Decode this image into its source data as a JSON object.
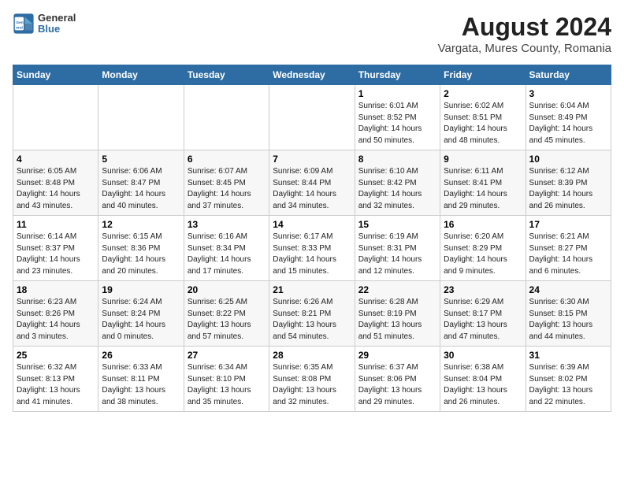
{
  "header": {
    "logo_line1": "General",
    "logo_line2": "Blue",
    "title": "August 2024",
    "subtitle": "Vargata, Mures County, Romania"
  },
  "days_of_week": [
    "Sunday",
    "Monday",
    "Tuesday",
    "Wednesday",
    "Thursday",
    "Friday",
    "Saturday"
  ],
  "weeks": [
    [
      {
        "day": "",
        "sunrise": "",
        "sunset": "",
        "daylight": ""
      },
      {
        "day": "",
        "sunrise": "",
        "sunset": "",
        "daylight": ""
      },
      {
        "day": "",
        "sunrise": "",
        "sunset": "",
        "daylight": ""
      },
      {
        "day": "",
        "sunrise": "",
        "sunset": "",
        "daylight": ""
      },
      {
        "day": "1",
        "sunrise": "Sunrise: 6:01 AM",
        "sunset": "Sunset: 8:52 PM",
        "daylight": "Daylight: 14 hours and 50 minutes."
      },
      {
        "day": "2",
        "sunrise": "Sunrise: 6:02 AM",
        "sunset": "Sunset: 8:51 PM",
        "daylight": "Daylight: 14 hours and 48 minutes."
      },
      {
        "day": "3",
        "sunrise": "Sunrise: 6:04 AM",
        "sunset": "Sunset: 8:49 PM",
        "daylight": "Daylight: 14 hours and 45 minutes."
      }
    ],
    [
      {
        "day": "4",
        "sunrise": "Sunrise: 6:05 AM",
        "sunset": "Sunset: 8:48 PM",
        "daylight": "Daylight: 14 hours and 43 minutes."
      },
      {
        "day": "5",
        "sunrise": "Sunrise: 6:06 AM",
        "sunset": "Sunset: 8:47 PM",
        "daylight": "Daylight: 14 hours and 40 minutes."
      },
      {
        "day": "6",
        "sunrise": "Sunrise: 6:07 AM",
        "sunset": "Sunset: 8:45 PM",
        "daylight": "Daylight: 14 hours and 37 minutes."
      },
      {
        "day": "7",
        "sunrise": "Sunrise: 6:09 AM",
        "sunset": "Sunset: 8:44 PM",
        "daylight": "Daylight: 14 hours and 34 minutes."
      },
      {
        "day": "8",
        "sunrise": "Sunrise: 6:10 AM",
        "sunset": "Sunset: 8:42 PM",
        "daylight": "Daylight: 14 hours and 32 minutes."
      },
      {
        "day": "9",
        "sunrise": "Sunrise: 6:11 AM",
        "sunset": "Sunset: 8:41 PM",
        "daylight": "Daylight: 14 hours and 29 minutes."
      },
      {
        "day": "10",
        "sunrise": "Sunrise: 6:12 AM",
        "sunset": "Sunset: 8:39 PM",
        "daylight": "Daylight: 14 hours and 26 minutes."
      }
    ],
    [
      {
        "day": "11",
        "sunrise": "Sunrise: 6:14 AM",
        "sunset": "Sunset: 8:37 PM",
        "daylight": "Daylight: 14 hours and 23 minutes."
      },
      {
        "day": "12",
        "sunrise": "Sunrise: 6:15 AM",
        "sunset": "Sunset: 8:36 PM",
        "daylight": "Daylight: 14 hours and 20 minutes."
      },
      {
        "day": "13",
        "sunrise": "Sunrise: 6:16 AM",
        "sunset": "Sunset: 8:34 PM",
        "daylight": "Daylight: 14 hours and 17 minutes."
      },
      {
        "day": "14",
        "sunrise": "Sunrise: 6:17 AM",
        "sunset": "Sunset: 8:33 PM",
        "daylight": "Daylight: 14 hours and 15 minutes."
      },
      {
        "day": "15",
        "sunrise": "Sunrise: 6:19 AM",
        "sunset": "Sunset: 8:31 PM",
        "daylight": "Daylight: 14 hours and 12 minutes."
      },
      {
        "day": "16",
        "sunrise": "Sunrise: 6:20 AM",
        "sunset": "Sunset: 8:29 PM",
        "daylight": "Daylight: 14 hours and 9 minutes."
      },
      {
        "day": "17",
        "sunrise": "Sunrise: 6:21 AM",
        "sunset": "Sunset: 8:27 PM",
        "daylight": "Daylight: 14 hours and 6 minutes."
      }
    ],
    [
      {
        "day": "18",
        "sunrise": "Sunrise: 6:23 AM",
        "sunset": "Sunset: 8:26 PM",
        "daylight": "Daylight: 14 hours and 3 minutes."
      },
      {
        "day": "19",
        "sunrise": "Sunrise: 6:24 AM",
        "sunset": "Sunset: 8:24 PM",
        "daylight": "Daylight: 14 hours and 0 minutes."
      },
      {
        "day": "20",
        "sunrise": "Sunrise: 6:25 AM",
        "sunset": "Sunset: 8:22 PM",
        "daylight": "Daylight: 13 hours and 57 minutes."
      },
      {
        "day": "21",
        "sunrise": "Sunrise: 6:26 AM",
        "sunset": "Sunset: 8:21 PM",
        "daylight": "Daylight: 13 hours and 54 minutes."
      },
      {
        "day": "22",
        "sunrise": "Sunrise: 6:28 AM",
        "sunset": "Sunset: 8:19 PM",
        "daylight": "Daylight: 13 hours and 51 minutes."
      },
      {
        "day": "23",
        "sunrise": "Sunrise: 6:29 AM",
        "sunset": "Sunset: 8:17 PM",
        "daylight": "Daylight: 13 hours and 47 minutes."
      },
      {
        "day": "24",
        "sunrise": "Sunrise: 6:30 AM",
        "sunset": "Sunset: 8:15 PM",
        "daylight": "Daylight: 13 hours and 44 minutes."
      }
    ],
    [
      {
        "day": "25",
        "sunrise": "Sunrise: 6:32 AM",
        "sunset": "Sunset: 8:13 PM",
        "daylight": "Daylight: 13 hours and 41 minutes."
      },
      {
        "day": "26",
        "sunrise": "Sunrise: 6:33 AM",
        "sunset": "Sunset: 8:11 PM",
        "daylight": "Daylight: 13 hours and 38 minutes."
      },
      {
        "day": "27",
        "sunrise": "Sunrise: 6:34 AM",
        "sunset": "Sunset: 8:10 PM",
        "daylight": "Daylight: 13 hours and 35 minutes."
      },
      {
        "day": "28",
        "sunrise": "Sunrise: 6:35 AM",
        "sunset": "Sunset: 8:08 PM",
        "daylight": "Daylight: 13 hours and 32 minutes."
      },
      {
        "day": "29",
        "sunrise": "Sunrise: 6:37 AM",
        "sunset": "Sunset: 8:06 PM",
        "daylight": "Daylight: 13 hours and 29 minutes."
      },
      {
        "day": "30",
        "sunrise": "Sunrise: 6:38 AM",
        "sunset": "Sunset: 8:04 PM",
        "daylight": "Daylight: 13 hours and 26 minutes."
      },
      {
        "day": "31",
        "sunrise": "Sunrise: 6:39 AM",
        "sunset": "Sunset: 8:02 PM",
        "daylight": "Daylight: 13 hours and 22 minutes."
      }
    ]
  ]
}
